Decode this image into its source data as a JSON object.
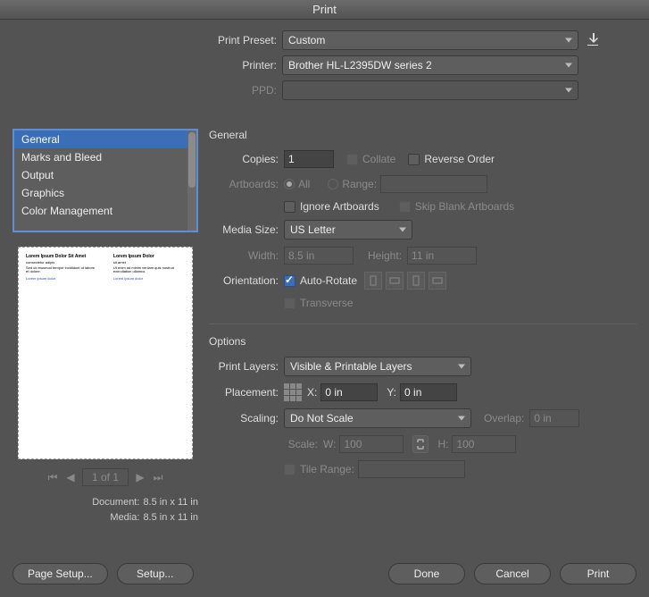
{
  "window_title": "Print",
  "top": {
    "preset_label": "Print Preset:",
    "preset_value": "Custom",
    "printer_label": "Printer:",
    "printer_value": "Brother HL-L2395DW series 2",
    "ppd_label": "PPD:",
    "ppd_value": ""
  },
  "list_items": [
    "General",
    "Marks and Bleed",
    "Output",
    "Graphics",
    "Color Management"
  ],
  "general": {
    "title": "General",
    "copies_label": "Copies:",
    "copies_value": "1",
    "collate_label": "Collate",
    "reverse_label": "Reverse Order",
    "artboards_label": "Artboards:",
    "all_label": "All",
    "range_label": "Range:",
    "range_value": "",
    "ignore_label": "Ignore Artboards",
    "skip_label": "Skip Blank Artboards",
    "media_label": "Media Size:",
    "media_value": "US Letter",
    "width_label": "Width:",
    "width_value": "8.5 in",
    "height_label": "Height:",
    "height_value": "11 in",
    "orientation_label": "Orientation:",
    "auto_rotate_label": "Auto-Rotate",
    "transverse_label": "Transverse"
  },
  "options": {
    "title": "Options",
    "layers_label": "Print Layers:",
    "layers_value": "Visible & Printable Layers",
    "placement_label": "Placement:",
    "x_label": "X:",
    "x_value": "0 in",
    "y_label": "Y:",
    "y_value": "0 in",
    "scaling_label": "Scaling:",
    "scaling_value": "Do Not Scale",
    "overlap_label": "Overlap:",
    "overlap_value": "0 in",
    "scale_label": "Scale:",
    "w_label": "W:",
    "w_value": "100",
    "h_label": "H:",
    "h_value": "100",
    "tile_label": "Tile Range:",
    "tile_value": ""
  },
  "pager": {
    "value": "1 of 1"
  },
  "meta": {
    "doc_k": "Document:",
    "doc_v": "8.5 in x 11 in",
    "media_k": "Media:",
    "media_v": "8.5 in x 11 in"
  },
  "buttons": {
    "page_setup": "Page Setup...",
    "setup": "Setup...",
    "done": "Done",
    "cancel": "Cancel",
    "print": "Print"
  }
}
